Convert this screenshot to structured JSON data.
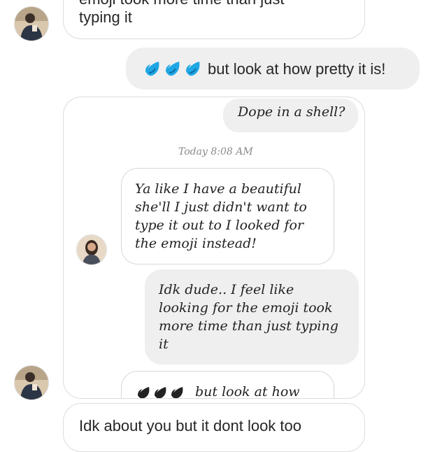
{
  "messages": {
    "top_partial_line": "emoji took more time than just",
    "top_line2": "typing it",
    "sent_text": "but look at how pretty it is!",
    "bottom_partial_line": "Idk about you but it dont look too"
  },
  "screenshot": {
    "dope_text": "Dope in a shell?",
    "timestamp": "Today 8:08 AM",
    "reply_lines": [
      "Ya like I have a beautiful",
      "she'll I just didn't want to",
      "type it out to I looked for",
      "the emoji instead!"
    ],
    "idk_lines": [
      "Idk dude.. I feel like",
      "looking for the emoji took",
      "more time than just typing",
      "it"
    ],
    "bottom_partial": "but look at how"
  },
  "icons": {
    "sweat_drop": "sweat-droplets-icon",
    "avatar_dark": "avatar-male",
    "avatar_light": "avatar-female"
  },
  "colors": {
    "drop_blue": "#1ea7e4",
    "drop_dark_blue": "#0d6fa8",
    "gray_bubble": "#efefef"
  }
}
